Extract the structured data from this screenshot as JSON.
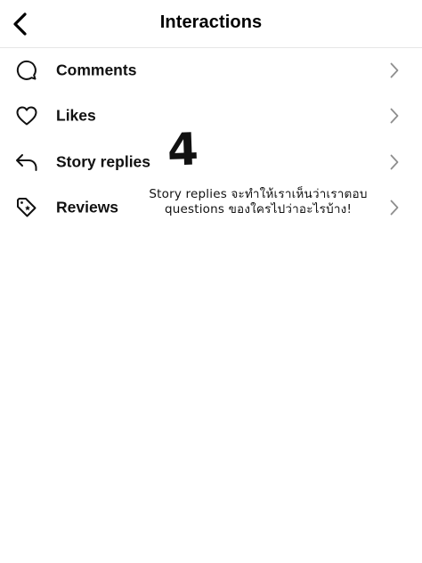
{
  "header": {
    "back_icon": "chevron-left-icon",
    "title": "Interactions"
  },
  "items": [
    {
      "label": "Comments",
      "icon": "comment-bubble-icon"
    },
    {
      "label": "Likes",
      "icon": "heart-icon"
    },
    {
      "label": "Story replies",
      "icon": "reply-arrow-icon"
    },
    {
      "label": "Reviews",
      "icon": "tag-star-icon"
    }
  ],
  "annotation": {
    "number": "4",
    "text": "Story replies จะทำให้เราเห็นว่าเราตอบ questions ของใครไปว่าอะไรบ้าง!"
  },
  "colors": {
    "background": "#ffffff",
    "text": "#111111",
    "chevron": "#8e8e8e",
    "divider": "#e6e6e6"
  }
}
